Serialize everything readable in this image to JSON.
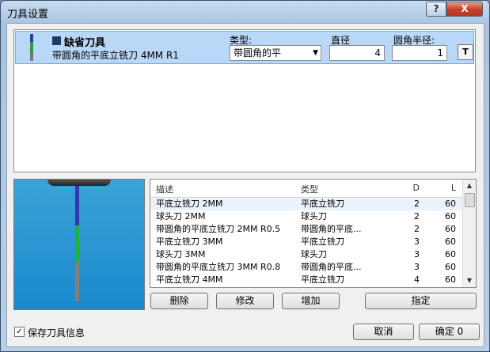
{
  "window": {
    "title": "刀具设置",
    "help_label": "?",
    "close_label": "X"
  },
  "tool": {
    "name": "缺省刀具",
    "description": "带圆角的平底立铣刀 4MM R1",
    "type_label": "类型:",
    "type_value": "带圆角的平",
    "diameter_label": "直径",
    "diameter_value": "4",
    "corner_radius_label": "圆角半径:",
    "corner_radius_value": "1",
    "icon": "tool-properties-icon"
  },
  "list": {
    "columns": [
      "描述",
      "类型",
      "D",
      "L"
    ],
    "rows": [
      {
        "desc": "平底立铣刀 2MM",
        "type": "平底立铣刀",
        "d": "2",
        "l": "60"
      },
      {
        "desc": "球头刀 2MM",
        "type": "球头刀",
        "d": "2",
        "l": "60"
      },
      {
        "desc": "带圆角的平底立铣刀 2MM R0.5",
        "type": "带圆角的平底...",
        "d": "2",
        "l": "60"
      },
      {
        "desc": "平底立铣刀 3MM",
        "type": "平底立铣刀",
        "d": "3",
        "l": "60"
      },
      {
        "desc": "球头刀 3MM",
        "type": "球头刀",
        "d": "3",
        "l": "60"
      },
      {
        "desc": "带圆角的平底立铣刀 3MM R0.8",
        "type": "带圆角的平底...",
        "d": "3",
        "l": "60"
      },
      {
        "desc": "平底立铣刀 4MM",
        "type": "平底立铣刀",
        "d": "4",
        "l": "60"
      }
    ]
  },
  "buttons": {
    "delete": "删除",
    "modify": "修改",
    "add": "增加",
    "assign": "指定",
    "cancel": "取消",
    "ok": "确定 0"
  },
  "save_checkbox": {
    "label": "保存刀具信息",
    "checked": true
  },
  "colors": {
    "selection": "#b9d7f7",
    "preview_bg": "#1a89cc",
    "shank": "#2b3bb0",
    "flute": "#22b040",
    "tip": "#808080"
  }
}
